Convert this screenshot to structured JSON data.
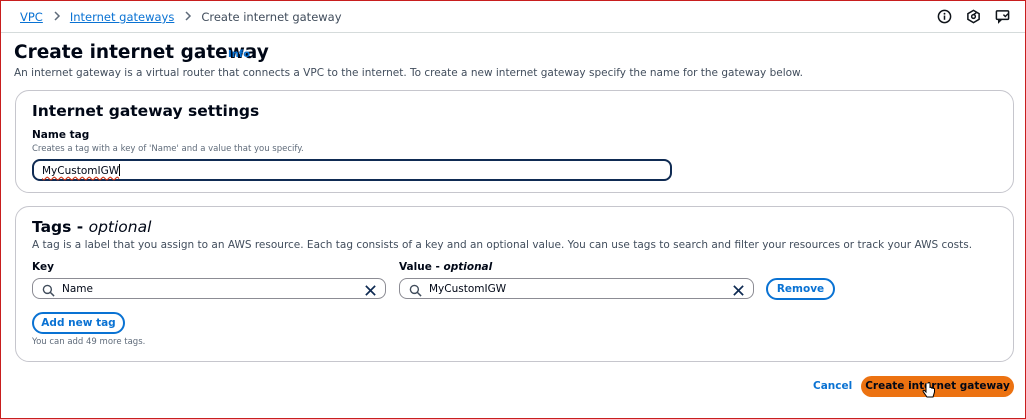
{
  "breadcrumb": {
    "items": [
      "VPC",
      "Internet gateways"
    ],
    "current": "Create internet gateway"
  },
  "header": {
    "title": "Create internet gateway",
    "info_label": "Info",
    "description": "An internet gateway is a virtual router that connects a VPC to the internet. To create a new internet gateway specify the name for the gateway below."
  },
  "settings": {
    "title": "Internet gateway settings",
    "name_tag_label": "Name tag",
    "name_tag_description": "Creates a tag with a key of 'Name' and a value that you specify.",
    "name_tag_value": "MyCustomIGW"
  },
  "tags": {
    "title": "Tags - ",
    "title_optional": "optional",
    "description": "A tag is a label that you assign to an AWS resource. Each tag consists of a key and an optional value. You can use tags to search and filter your resources or track your AWS costs.",
    "key_label": "Key",
    "value_label": "Value - ",
    "value_optional": "optional",
    "rows": [
      {
        "key": "Name",
        "value": "MyCustomIGW"
      }
    ],
    "remove_label": "Remove",
    "add_label": "Add new tag",
    "remaining_text": "You can add 49 more tags."
  },
  "footer": {
    "cancel_label": "Cancel",
    "submit_label": "Create internet gateway"
  },
  "icons": {
    "top_right": [
      "info-icon",
      "notification-icon",
      "feedback-icon"
    ]
  },
  "colors": {
    "link": "#0972d3",
    "primary": "#ec7211",
    "input_focus": "#0f2b53"
  }
}
